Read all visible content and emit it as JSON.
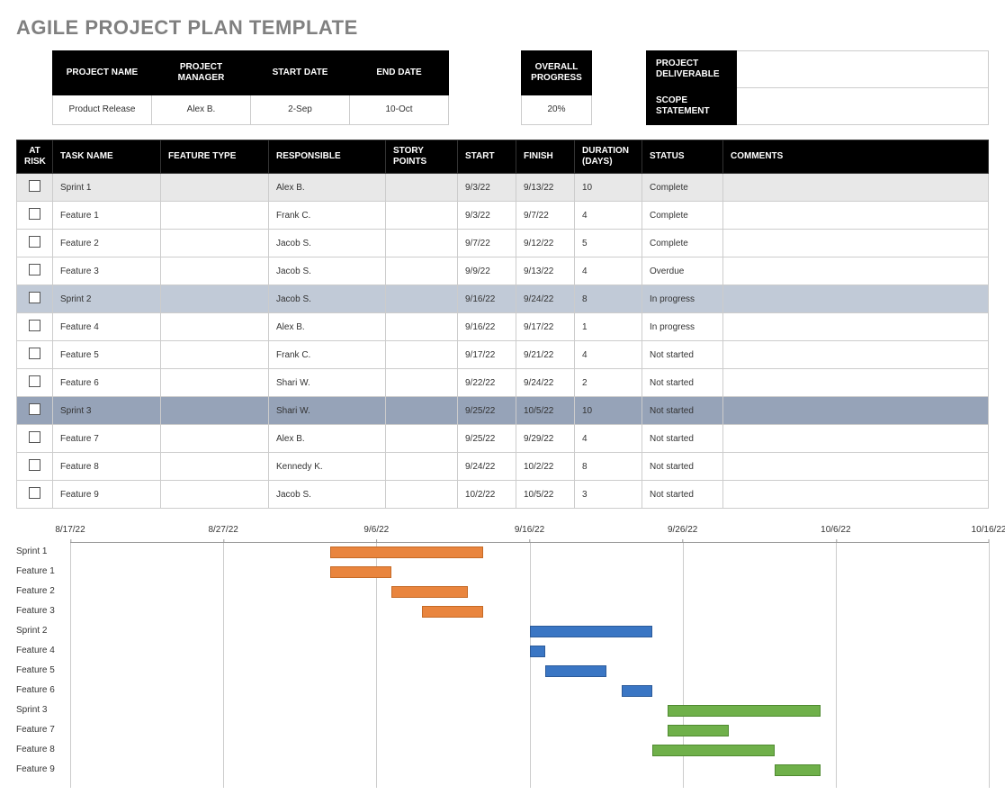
{
  "title": "AGILE PROJECT PLAN TEMPLATE",
  "info": {
    "headers": {
      "project_name": "PROJECT NAME",
      "project_manager": "PROJECT MANAGER",
      "start_date": "START DATE",
      "end_date": "END DATE"
    },
    "values": {
      "project_name": "Product Release",
      "project_manager": "Alex B.",
      "start_date": "2-Sep",
      "end_date": "10-Oct"
    }
  },
  "progress": {
    "header": "OVERALL PROGRESS",
    "value": "20%"
  },
  "deliverable": {
    "project_deliverable": "PROJECT DELIVERABLE",
    "scope_statement": "SCOPE STATEMENT",
    "project_deliverable_val": "",
    "scope_statement_val": ""
  },
  "task_headers": {
    "at_risk": "AT RISK",
    "task_name": "TASK NAME",
    "feature_type": "FEATURE TYPE",
    "responsible": "RESPONSIBLE",
    "story_points": "STORY POINTS",
    "start": "START",
    "finish": "FINISH",
    "duration": "DURATION (DAYS)",
    "status": "STATUS",
    "comments": "COMMENTS"
  },
  "tasks": [
    {
      "shade": "light",
      "name": "Sprint 1",
      "ftype": "",
      "resp": "Alex B.",
      "points": "",
      "start": "9/3/22",
      "finish": "9/13/22",
      "dur": "10",
      "status": "Complete",
      "comments": ""
    },
    {
      "shade": "",
      "name": "Feature 1",
      "ftype": "",
      "resp": "Frank C.",
      "points": "",
      "start": "9/3/22",
      "finish": "9/7/22",
      "dur": "4",
      "status": "Complete",
      "comments": ""
    },
    {
      "shade": "",
      "name": "Feature 2",
      "ftype": "",
      "resp": "Jacob S.",
      "points": "",
      "start": "9/7/22",
      "finish": "9/12/22",
      "dur": "5",
      "status": "Complete",
      "comments": ""
    },
    {
      "shade": "",
      "name": "Feature 3",
      "ftype": "",
      "resp": "Jacob S.",
      "points": "",
      "start": "9/9/22",
      "finish": "9/13/22",
      "dur": "4",
      "status": "Overdue",
      "comments": ""
    },
    {
      "shade": "blue",
      "name": "Sprint 2",
      "ftype": "",
      "resp": "Jacob S.",
      "points": "",
      "start": "9/16/22",
      "finish": "9/24/22",
      "dur": "8",
      "status": "In progress",
      "comments": ""
    },
    {
      "shade": "",
      "name": "Feature 4",
      "ftype": "",
      "resp": "Alex B.",
      "points": "",
      "start": "9/16/22",
      "finish": "9/17/22",
      "dur": "1",
      "status": "In progress",
      "comments": ""
    },
    {
      "shade": "",
      "name": "Feature 5",
      "ftype": "",
      "resp": "Frank C.",
      "points": "",
      "start": "9/17/22",
      "finish": "9/21/22",
      "dur": "4",
      "status": "Not started",
      "comments": ""
    },
    {
      "shade": "",
      "name": "Feature 6",
      "ftype": "",
      "resp": "Shari W.",
      "points": "",
      "start": "9/22/22",
      "finish": "9/24/22",
      "dur": "2",
      "status": "Not started",
      "comments": ""
    },
    {
      "shade": "steel",
      "name": "Sprint 3",
      "ftype": "",
      "resp": "Shari W.",
      "points": "",
      "start": "9/25/22",
      "finish": "10/5/22",
      "dur": "10",
      "status": "Not started",
      "comments": ""
    },
    {
      "shade": "",
      "name": "Feature 7",
      "ftype": "",
      "resp": "Alex B.",
      "points": "",
      "start": "9/25/22",
      "finish": "9/29/22",
      "dur": "4",
      "status": "Not started",
      "comments": ""
    },
    {
      "shade": "",
      "name": "Feature 8",
      "ftype": "",
      "resp": "Kennedy K.",
      "points": "",
      "start": "9/24/22",
      "finish": "10/2/22",
      "dur": "8",
      "status": "Not started",
      "comments": ""
    },
    {
      "shade": "",
      "name": "Feature 9",
      "ftype": "",
      "resp": "Jacob S.",
      "points": "",
      "start": "10/2/22",
      "finish": "10/5/22",
      "dur": "3",
      "status": "Not started",
      "comments": ""
    }
  ],
  "chart_data": {
    "type": "bar",
    "orientation": "horizontal-gantt",
    "x_axis_ticks": [
      "8/17/22",
      "8/27/22",
      "9/6/22",
      "9/16/22",
      "9/26/22",
      "10/6/22",
      "10/16/22"
    ],
    "x_range_days": {
      "start": "2022-08-17",
      "end": "2022-10-16",
      "span_days": 60
    },
    "series": [
      {
        "name": "Sprint 1",
        "color": "orange",
        "start": "2022-09-03",
        "end": "2022-09-13"
      },
      {
        "name": "Feature 1",
        "color": "orange",
        "start": "2022-09-03",
        "end": "2022-09-07"
      },
      {
        "name": "Feature 2",
        "color": "orange",
        "start": "2022-09-07",
        "end": "2022-09-12"
      },
      {
        "name": "Feature 3",
        "color": "orange",
        "start": "2022-09-09",
        "end": "2022-09-13"
      },
      {
        "name": "Sprint 2",
        "color": "blue",
        "start": "2022-09-16",
        "end": "2022-09-24"
      },
      {
        "name": "Feature 4",
        "color": "blue",
        "start": "2022-09-16",
        "end": "2022-09-17"
      },
      {
        "name": "Feature 5",
        "color": "blue",
        "start": "2022-09-17",
        "end": "2022-09-21"
      },
      {
        "name": "Feature 6",
        "color": "blue",
        "start": "2022-09-22",
        "end": "2022-09-24"
      },
      {
        "name": "Sprint 3",
        "color": "green",
        "start": "2022-09-25",
        "end": "2022-10-05"
      },
      {
        "name": "Feature 7",
        "color": "green",
        "start": "2022-09-25",
        "end": "2022-09-29"
      },
      {
        "name": "Feature 8",
        "color": "green",
        "start": "2022-09-24",
        "end": "2022-10-02"
      },
      {
        "name": "Feature 9",
        "color": "green",
        "start": "2022-10-02",
        "end": "2022-10-05"
      }
    ],
    "colors": {
      "orange": "#e9853e",
      "blue": "#3a76c4",
      "green": "#6fb04a"
    }
  }
}
